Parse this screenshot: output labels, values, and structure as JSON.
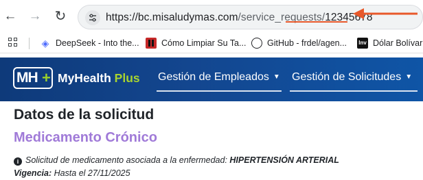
{
  "browser": {
    "url_host": "https://bc.misaludymas.com",
    "url_path": "/service_requests/",
    "url_request_id": "12345678",
    "annotation_color": "#e8582a"
  },
  "bookmarks": [
    {
      "label": "DeepSeek - Into the...",
      "icon": "deepseek-icon"
    },
    {
      "label": "Cómo Limpiar Su Ta...",
      "icon": "pause-icon"
    },
    {
      "label": "GitHub - frdel/agen...",
      "icon": "github-icon"
    },
    {
      "label": "Dólar Bolívar v",
      "icon": "investing-icon"
    }
  ],
  "investing_abbr": "Inv",
  "app": {
    "logo_letters": "MH",
    "logo_plus": "+",
    "brand_main": "MyHealth",
    "brand_accent": "Plus",
    "brand_color": "#13468f",
    "accent_color": "#a8d42f",
    "nav": [
      {
        "label": "Gestión de Empleados"
      },
      {
        "label": "Gestión de Solicitudes"
      }
    ]
  },
  "content": {
    "title": "Datos de la solicitud",
    "subtitle": "Medicamento Crónico",
    "subtitle_color": "#a07ad8",
    "info_text": "Solicitud de medicamento asociada a la enfermedad: ",
    "disease": "HIPERTENSIÓN ARTERIAL",
    "vigencia_label": "Vigencia:",
    "vigencia_value": " Hasta el 27/11/2025"
  }
}
